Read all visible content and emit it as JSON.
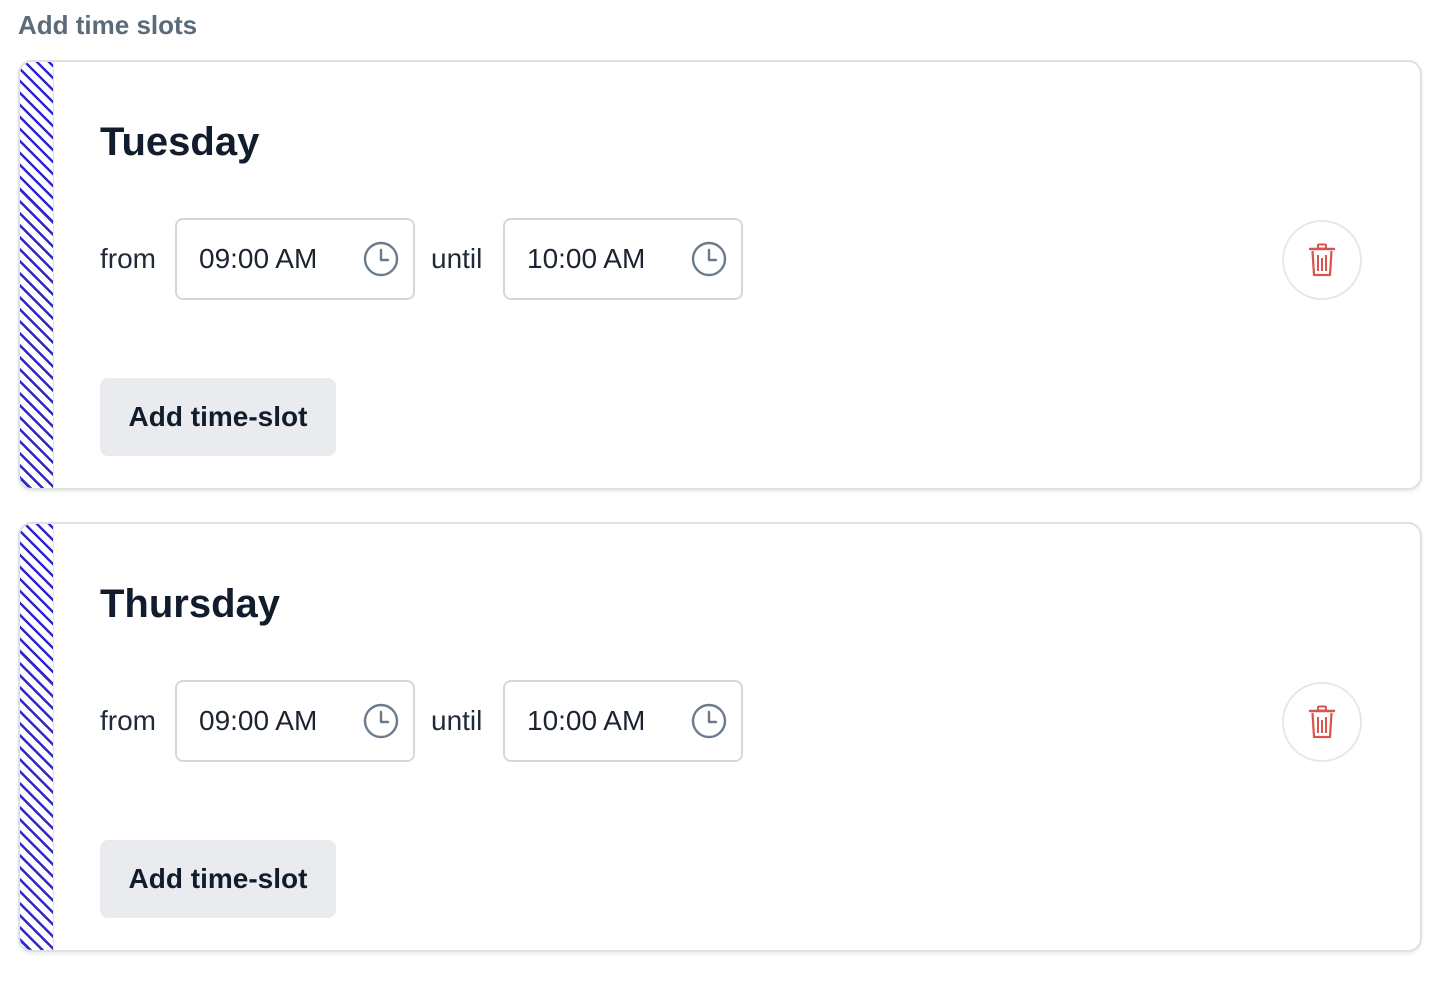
{
  "page": {
    "section_title": "Add time slots"
  },
  "colors": {
    "stripe": "#2f27c9",
    "delete_icon": "#d9534f",
    "clock_icon": "#6b7b8c"
  },
  "days": [
    {
      "name": "Tuesday",
      "from_label": "from",
      "until_label": "until",
      "start_time": "09:00 AM",
      "end_time": "10:00 AM",
      "start_icon": "clock-icon",
      "end_icon": "clock-icon",
      "delete_icon": "trash-icon",
      "add_button_label": "Add time-slot"
    },
    {
      "name": "Thursday",
      "from_label": "from",
      "until_label": "until",
      "start_time": "09:00 AM",
      "end_time": "10:00 AM",
      "start_icon": "clock-icon",
      "end_icon": "clock-icon",
      "delete_icon": "trash-icon",
      "add_button_label": "Add time-slot"
    }
  ]
}
